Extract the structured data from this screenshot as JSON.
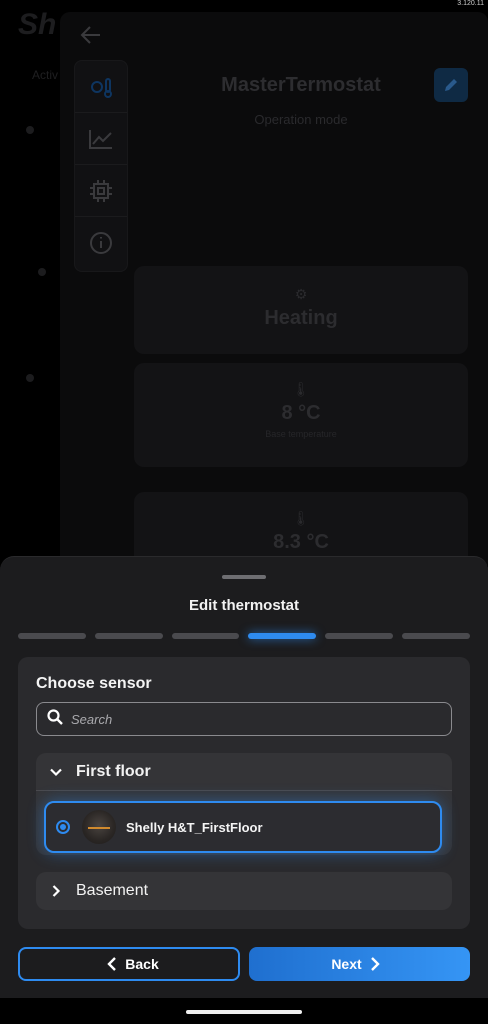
{
  "status": {
    "version": "3.120.11"
  },
  "background": {
    "logo": "Sh",
    "side_label": "Activ",
    "title": "MasterTermostat",
    "subtitle": "Operation mode",
    "cards": [
      {
        "value": "Heating",
        "label": ""
      },
      {
        "value": "8 °C",
        "label": "Base temperature"
      },
      {
        "value": "8.3 °C",
        "label": ""
      }
    ],
    "tabs": [
      "thermostat-icon",
      "chart-icon",
      "chip-icon",
      "info-icon"
    ]
  },
  "sheet": {
    "title": "Edit thermostat",
    "steps_total": 6,
    "active_step": 4,
    "choose_label": "Choose sensor",
    "search": {
      "placeholder": "Search",
      "value": ""
    },
    "groups": [
      {
        "name": "First floor",
        "expanded": true,
        "devices": [
          {
            "name": "Shelly H&T_FirstFloor",
            "selected": true
          }
        ]
      },
      {
        "name": "Basement",
        "expanded": false,
        "devices": []
      }
    ],
    "back_label": "Back",
    "next_label": "Next"
  },
  "colors": {
    "accent": "#2e8bf0",
    "sheet_bg": "#1c1c1e",
    "card_bg": "#2a2a2d"
  }
}
